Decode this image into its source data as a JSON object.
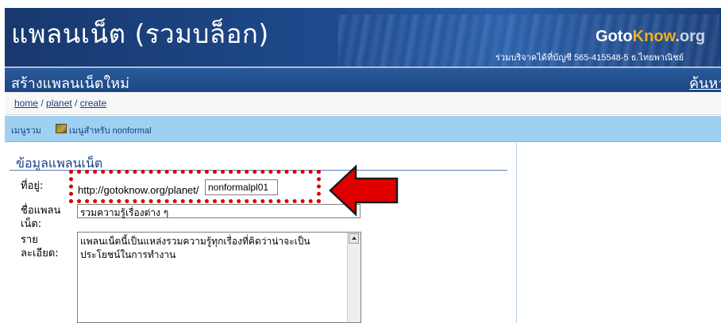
{
  "banner": {
    "site_title": "แพลนเน็ต (รวมบล็อก)",
    "logo_goto": "Goto",
    "logo_know": "Know",
    "logo_org": ".org",
    "donate_text": "ร่วมบริจาคได้ที่บัญชี 565-415548-5 ธ.ไทยพาณิชย์"
  },
  "titlebar": {
    "heading": "สร้างแพลนเน็ตใหม่",
    "search_link": "ค้นหา"
  },
  "breadcrumb": {
    "items": [
      "home",
      "planet",
      "create"
    ],
    "separator": " / "
  },
  "menu": {
    "main_label": "เมนูรวม",
    "sub_label": "เมนูสำหรับ nonformal"
  },
  "form": {
    "section_title": "ข้อมูลแพลนเน็ต",
    "address_label": "ที่อยู่:",
    "url_prefix": "http://gotoknow.org/planet/",
    "slug_value": "nonformalpl01",
    "name_label_line1": "ชื่อแพลน",
    "name_label_line2": "เน็ต:",
    "name_value": "รวมความรู้เรื่องต่าง ๆ",
    "desc_label_line1": "ราย",
    "desc_label_line2": "ละเอียด:",
    "desc_value": "แพลนเน็ตนี้เป็นแหล่งรวมความรู้ทุกเรื่องที่คิดว่าน่าจะเป็นประโยชน์ในการทำงาน"
  },
  "annotation": {
    "highlight_color": "#d90000",
    "arrow_color": "#e00000"
  }
}
